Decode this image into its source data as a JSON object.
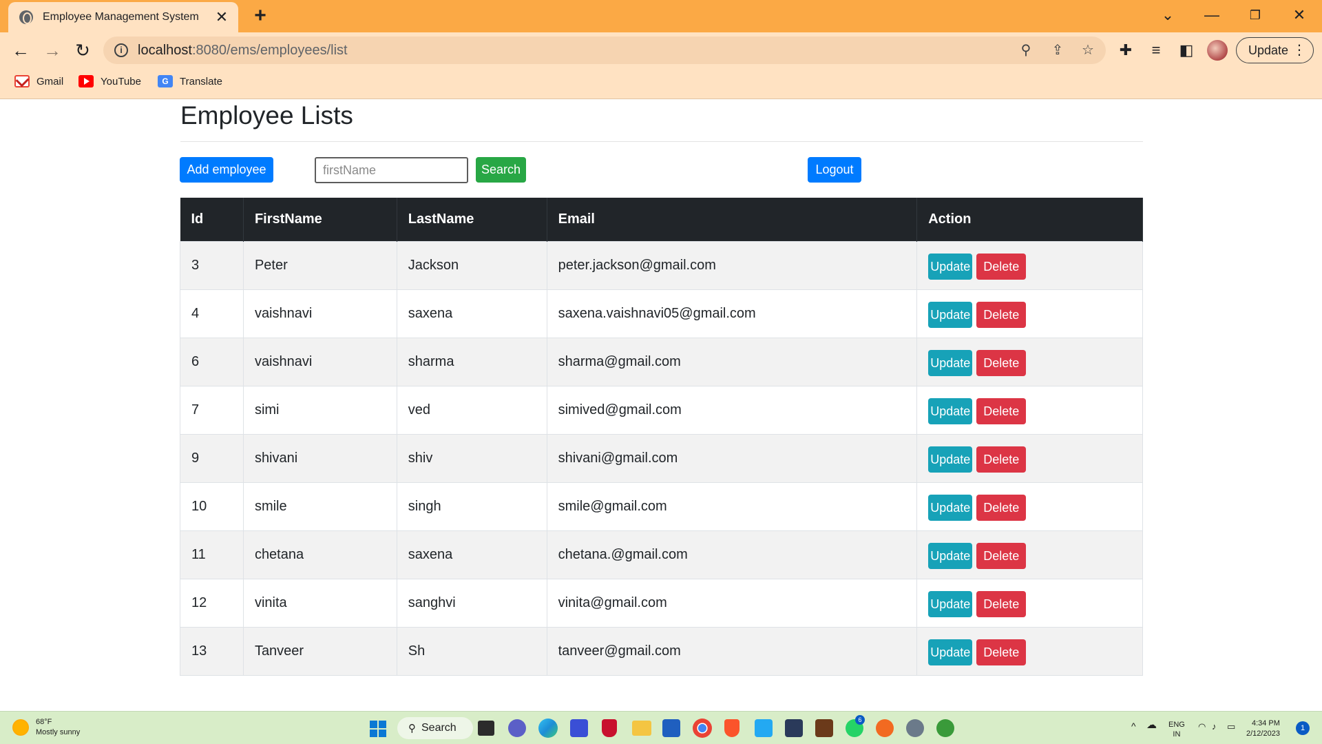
{
  "browser": {
    "tab_title": "Employee Management System",
    "tab_close": "✕",
    "new_tab": "+",
    "url_host": "localhost",
    "url_path": ":8080/ems/employees/list",
    "update_label": "Update",
    "bookmarks": [
      {
        "label": "Gmail",
        "icon": "gmail-icon"
      },
      {
        "label": "YouTube",
        "icon": "youtube-icon"
      },
      {
        "label": "Translate",
        "icon": "translate-icon"
      }
    ]
  },
  "page": {
    "title": "Employee Lists",
    "add_button": "Add employee",
    "search_placeholder": "firstName",
    "search_button": "Search",
    "logout_button": "Logout"
  },
  "table": {
    "headers": [
      "Id",
      "FirstName",
      "LastName",
      "Email",
      "Action"
    ],
    "update_label": "Update",
    "delete_label": "Delete",
    "rows": [
      {
        "id": "3",
        "first": "Peter",
        "last": "Jackson",
        "email": "peter.jackson@gmail.com"
      },
      {
        "id": "4",
        "first": "vaishnavi",
        "last": "saxena",
        "email": "saxena.vaishnavi05@gmail.com"
      },
      {
        "id": "6",
        "first": "vaishnavi",
        "last": "sharma",
        "email": "sharma@gmail.com"
      },
      {
        "id": "7",
        "first": "simi",
        "last": "ved",
        "email": "simived@gmail.com"
      },
      {
        "id": "9",
        "first": "shivani",
        "last": "shiv",
        "email": "shivani@gmail.com"
      },
      {
        "id": "10",
        "first": "smile",
        "last": "singh",
        "email": "smile@gmail.com"
      },
      {
        "id": "11",
        "first": "chetana",
        "last": "saxena",
        "email": "chetana.@gmail.com"
      },
      {
        "id": "12",
        "first": "vinita",
        "last": "sanghvi",
        "email": "vinita@gmail.com"
      },
      {
        "id": "13",
        "first": "Tanveer",
        "last": "Sh",
        "email": "tanveer@gmail.com"
      }
    ]
  },
  "taskbar": {
    "weather_temp": "68°F",
    "weather_desc": "Mostly sunny",
    "search_label": "Search",
    "lang_top": "ENG",
    "lang_bottom": "IN",
    "time": "4:34 PM",
    "date": "2/12/2023",
    "notification_count": "1",
    "whatsapp_badge": "6"
  },
  "colors": {
    "tab_strip": "#fba945",
    "chrome": "#ffe2c2",
    "primary": "#007bff",
    "success": "#28a745",
    "info": "#17a2b8",
    "danger": "#dc3545",
    "table_header": "#212529"
  }
}
